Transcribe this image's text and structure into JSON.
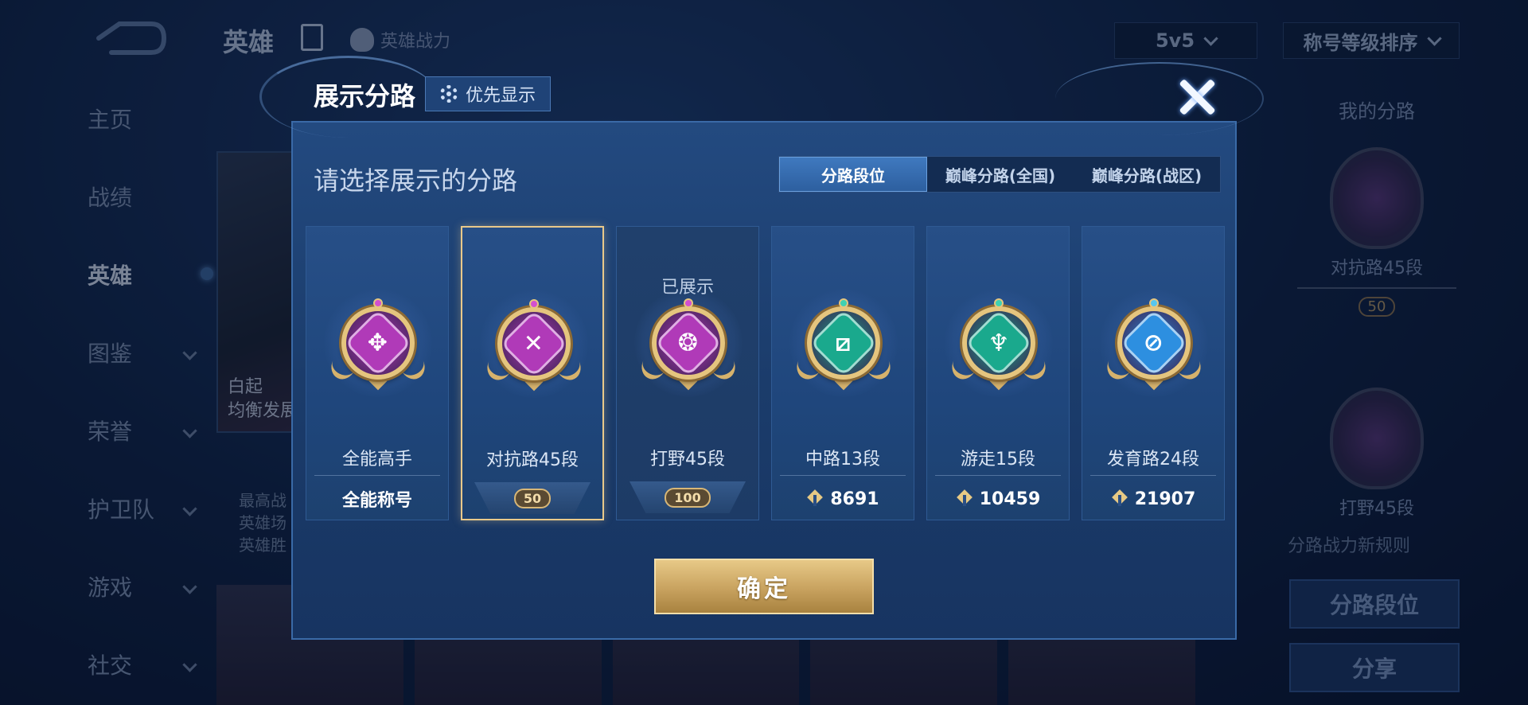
{
  "background": {
    "header": {
      "title": "英雄",
      "power_label": "英雄战力",
      "mode_dropdown": "5v5",
      "sort_dropdown": "称号等级排序"
    },
    "sidenav": [
      {
        "label": "主页",
        "has_chevron": false
      },
      {
        "label": "战绩",
        "has_chevron": false
      },
      {
        "label": "英雄",
        "has_chevron": false,
        "active": true
      },
      {
        "label": "图鉴",
        "has_chevron": true
      },
      {
        "label": "荣誉",
        "has_chevron": true
      },
      {
        "label": "护卫队",
        "has_chevron": true
      },
      {
        "label": "游戏",
        "has_chevron": true
      },
      {
        "label": "社交",
        "has_chevron": true
      }
    ],
    "hero": {
      "name": "白起",
      "role": "均衡发展"
    },
    "hero_info": [
      "最高战",
      "英雄场",
      "英雄胜"
    ],
    "right_panel": {
      "title": "我的分路",
      "badge1_label": "对抗路45段",
      "badge1_chip": "50",
      "badge2_label": "打野45段",
      "rules_link": "分路战力新规则",
      "btn_lane_rank": "分路段位",
      "btn_share": "分享"
    }
  },
  "modal": {
    "title": "展示分路",
    "priority_button": "优先显示",
    "subtitle": "请选择展示的分路",
    "tabs": [
      {
        "label": "分路段位",
        "active": true
      },
      {
        "label": "巅峰分路(全国)",
        "active": false
      },
      {
        "label": "巅峰分路(战区)",
        "active": false
      }
    ],
    "cards": [
      {
        "name": "全能高手",
        "footer_type": "text",
        "footer": "全能称号",
        "color": "#b03ab8",
        "glyph": "✥",
        "gem": "#d34fd0",
        "shown": false,
        "selected": false
      },
      {
        "name": "对抗路45段",
        "footer_type": "stars",
        "footer": "50",
        "color": "#b03ab8",
        "glyph": "✕",
        "gem": "#d34fd0",
        "shown": false,
        "selected": true
      },
      {
        "name": "打野45段",
        "footer_type": "stars",
        "footer": "100",
        "color": "#b03ab8",
        "glyph": "❂",
        "gem": "#d34fd0",
        "shown": true,
        "shown_label": "已展示",
        "selected": false
      },
      {
        "name": "中路13段",
        "footer_type": "power",
        "footer": "8691",
        "color": "#1aa98d",
        "glyph": "⧄",
        "gem": "#3fd1b2",
        "shown": false,
        "selected": false
      },
      {
        "name": "游走15段",
        "footer_type": "power",
        "footer": "10459",
        "color": "#1aa98d",
        "glyph": "♆",
        "gem": "#3fd1b2",
        "shown": false,
        "selected": false
      },
      {
        "name": "发育路24段",
        "footer_type": "power",
        "footer": "21907",
        "color": "#2d8fe0",
        "glyph": "⊘",
        "gem": "#56c6ef",
        "shown": false,
        "selected": false
      }
    ],
    "confirm_button": "确定"
  }
}
